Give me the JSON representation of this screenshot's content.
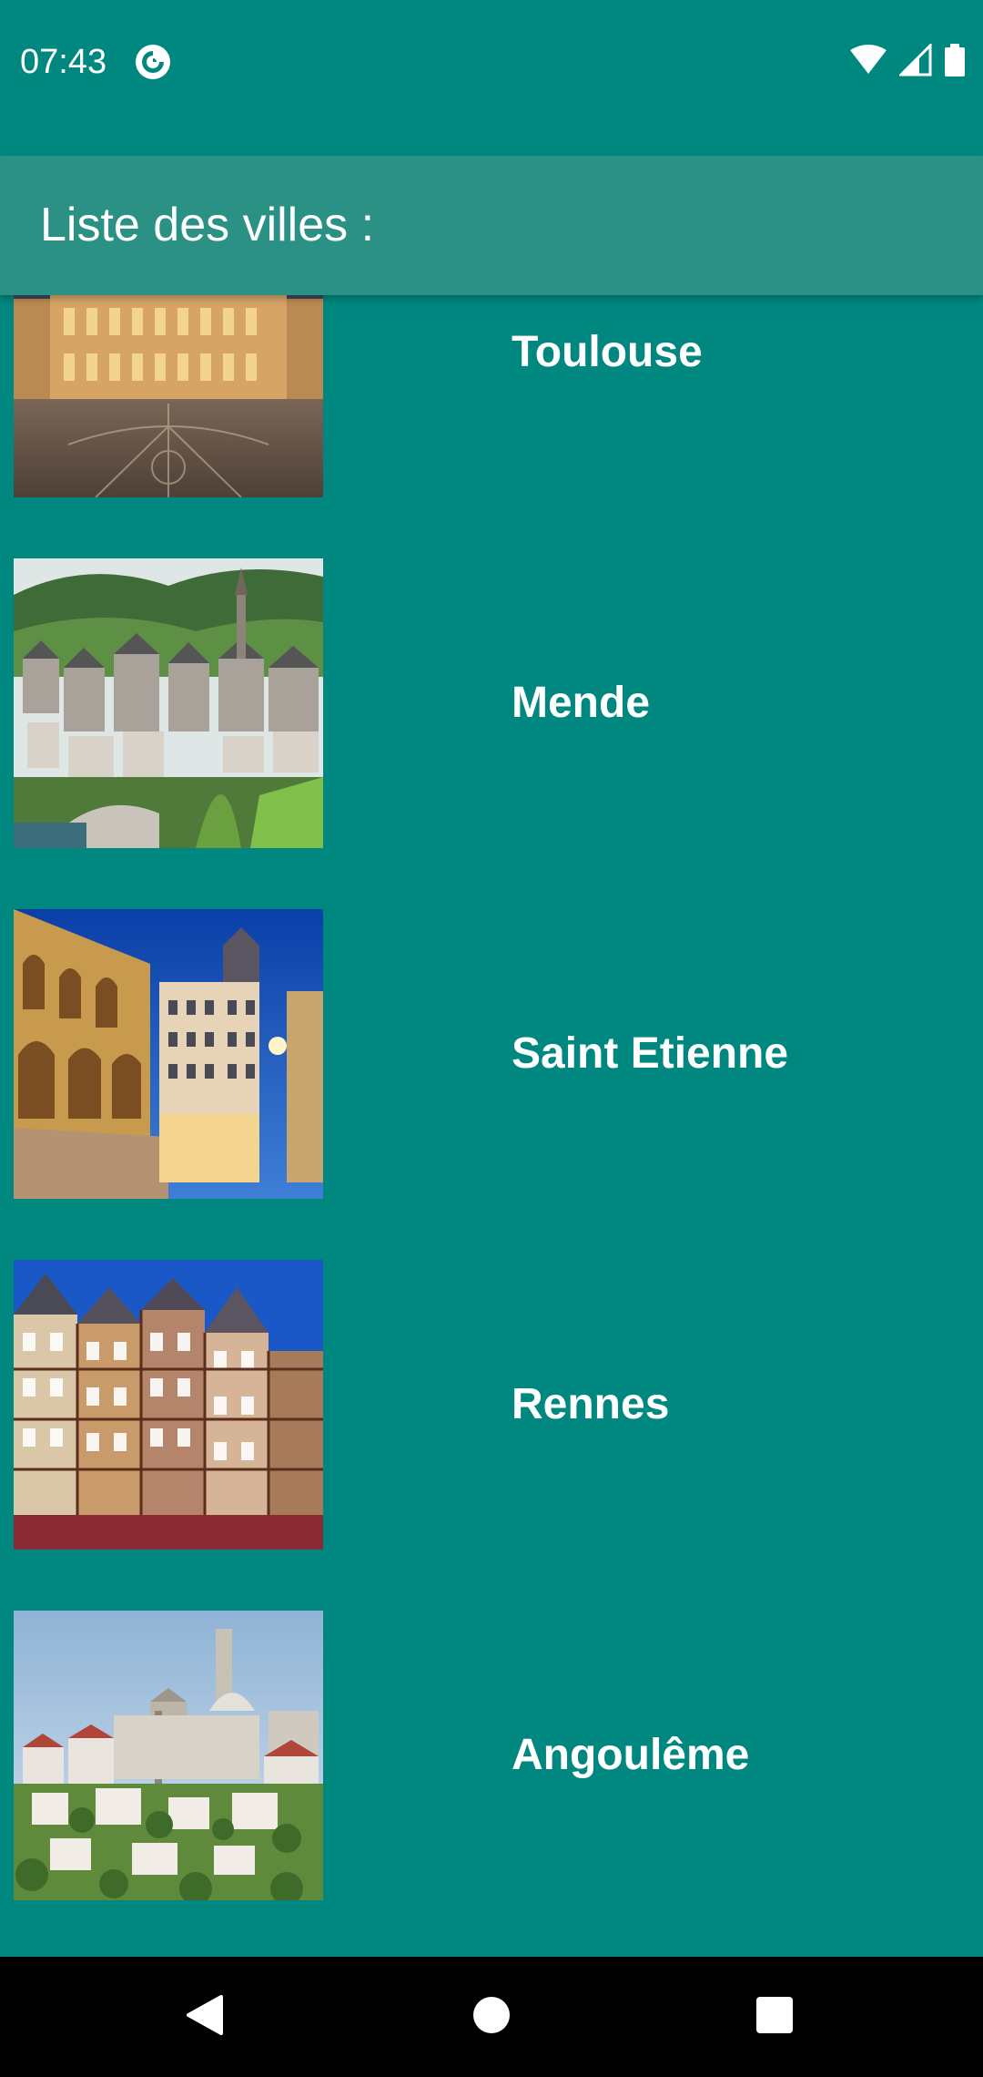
{
  "status_bar": {
    "time": "07:43",
    "app_icon": "pocket-casts-icon",
    "icons": [
      "wifi-icon",
      "signal-icon",
      "battery-icon"
    ]
  },
  "app_bar": {
    "title": "Liste des villes :"
  },
  "cities": [
    {
      "name": "Toulouse",
      "image": "toulouse-capitole-photo"
    },
    {
      "name": "Mende",
      "image": "mende-town-photo"
    },
    {
      "name": "Saint Etienne",
      "image": "saint-etienne-buildings-photo"
    },
    {
      "name": "Rennes",
      "image": "rennes-timbered-houses-photo"
    },
    {
      "name": "Angoulême",
      "image": "angouleme-cathedral-photo"
    }
  ],
  "nav_bar": {
    "buttons": [
      "back-icon",
      "home-icon",
      "recents-icon"
    ]
  },
  "colors": {
    "background": "#00877f",
    "app_bar": "#2a9184",
    "text": "#ffffff",
    "nav_bar": "#000000"
  }
}
